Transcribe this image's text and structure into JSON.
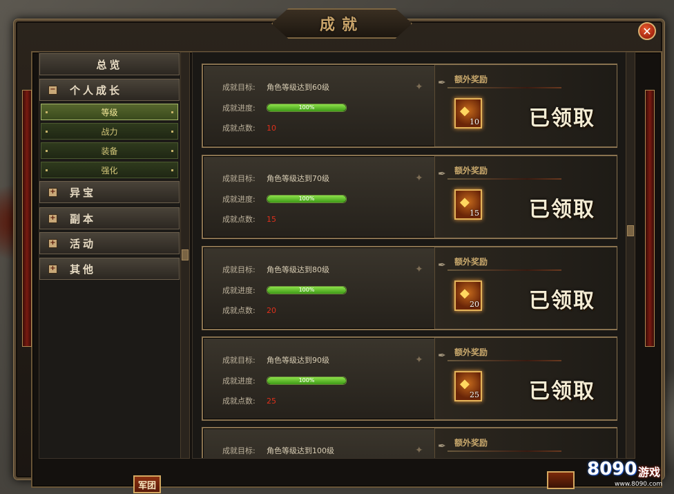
{
  "window": {
    "title": "成就"
  },
  "menu": {
    "overview": "总览",
    "personal_growth": "个人成长",
    "sub_items": [
      "等级",
      "战力",
      "装备",
      "强化"
    ],
    "categories": [
      "异宝",
      "副本",
      "活动",
      "其他"
    ]
  },
  "labels": {
    "goal": "成就目标:",
    "progress": "成就进度:",
    "points": "成就点数:",
    "extra_reward": "额外奖励",
    "claimed": "已领取"
  },
  "achievements": [
    {
      "goal": "角色等级达到60级",
      "progress_text": "100%",
      "progress": 1.0,
      "points": "10",
      "reward_count": "10",
      "claimed": true
    },
    {
      "goal": "角色等级达到70级",
      "progress_text": "100%",
      "progress": 1.0,
      "points": "15",
      "reward_count": "15",
      "claimed": true
    },
    {
      "goal": "角色等级达到80级",
      "progress_text": "100%",
      "progress": 1.0,
      "points": "20",
      "reward_count": "20",
      "claimed": true
    },
    {
      "goal": "角色等级达到90级",
      "progress_text": "100%",
      "progress": 1.0,
      "points": "25",
      "reward_count": "25",
      "claimed": true
    },
    {
      "goal": "角色等级达到100级"
    }
  ],
  "bottom": {
    "legion_button": "军团"
  },
  "watermark": {
    "brand": "8090",
    "game": "游戏",
    "url": "www.8090.com"
  },
  "colors": {
    "progress_fill": "#5cc02a",
    "points_red": "#e0301c",
    "gold_frame": "#8a7350"
  }
}
